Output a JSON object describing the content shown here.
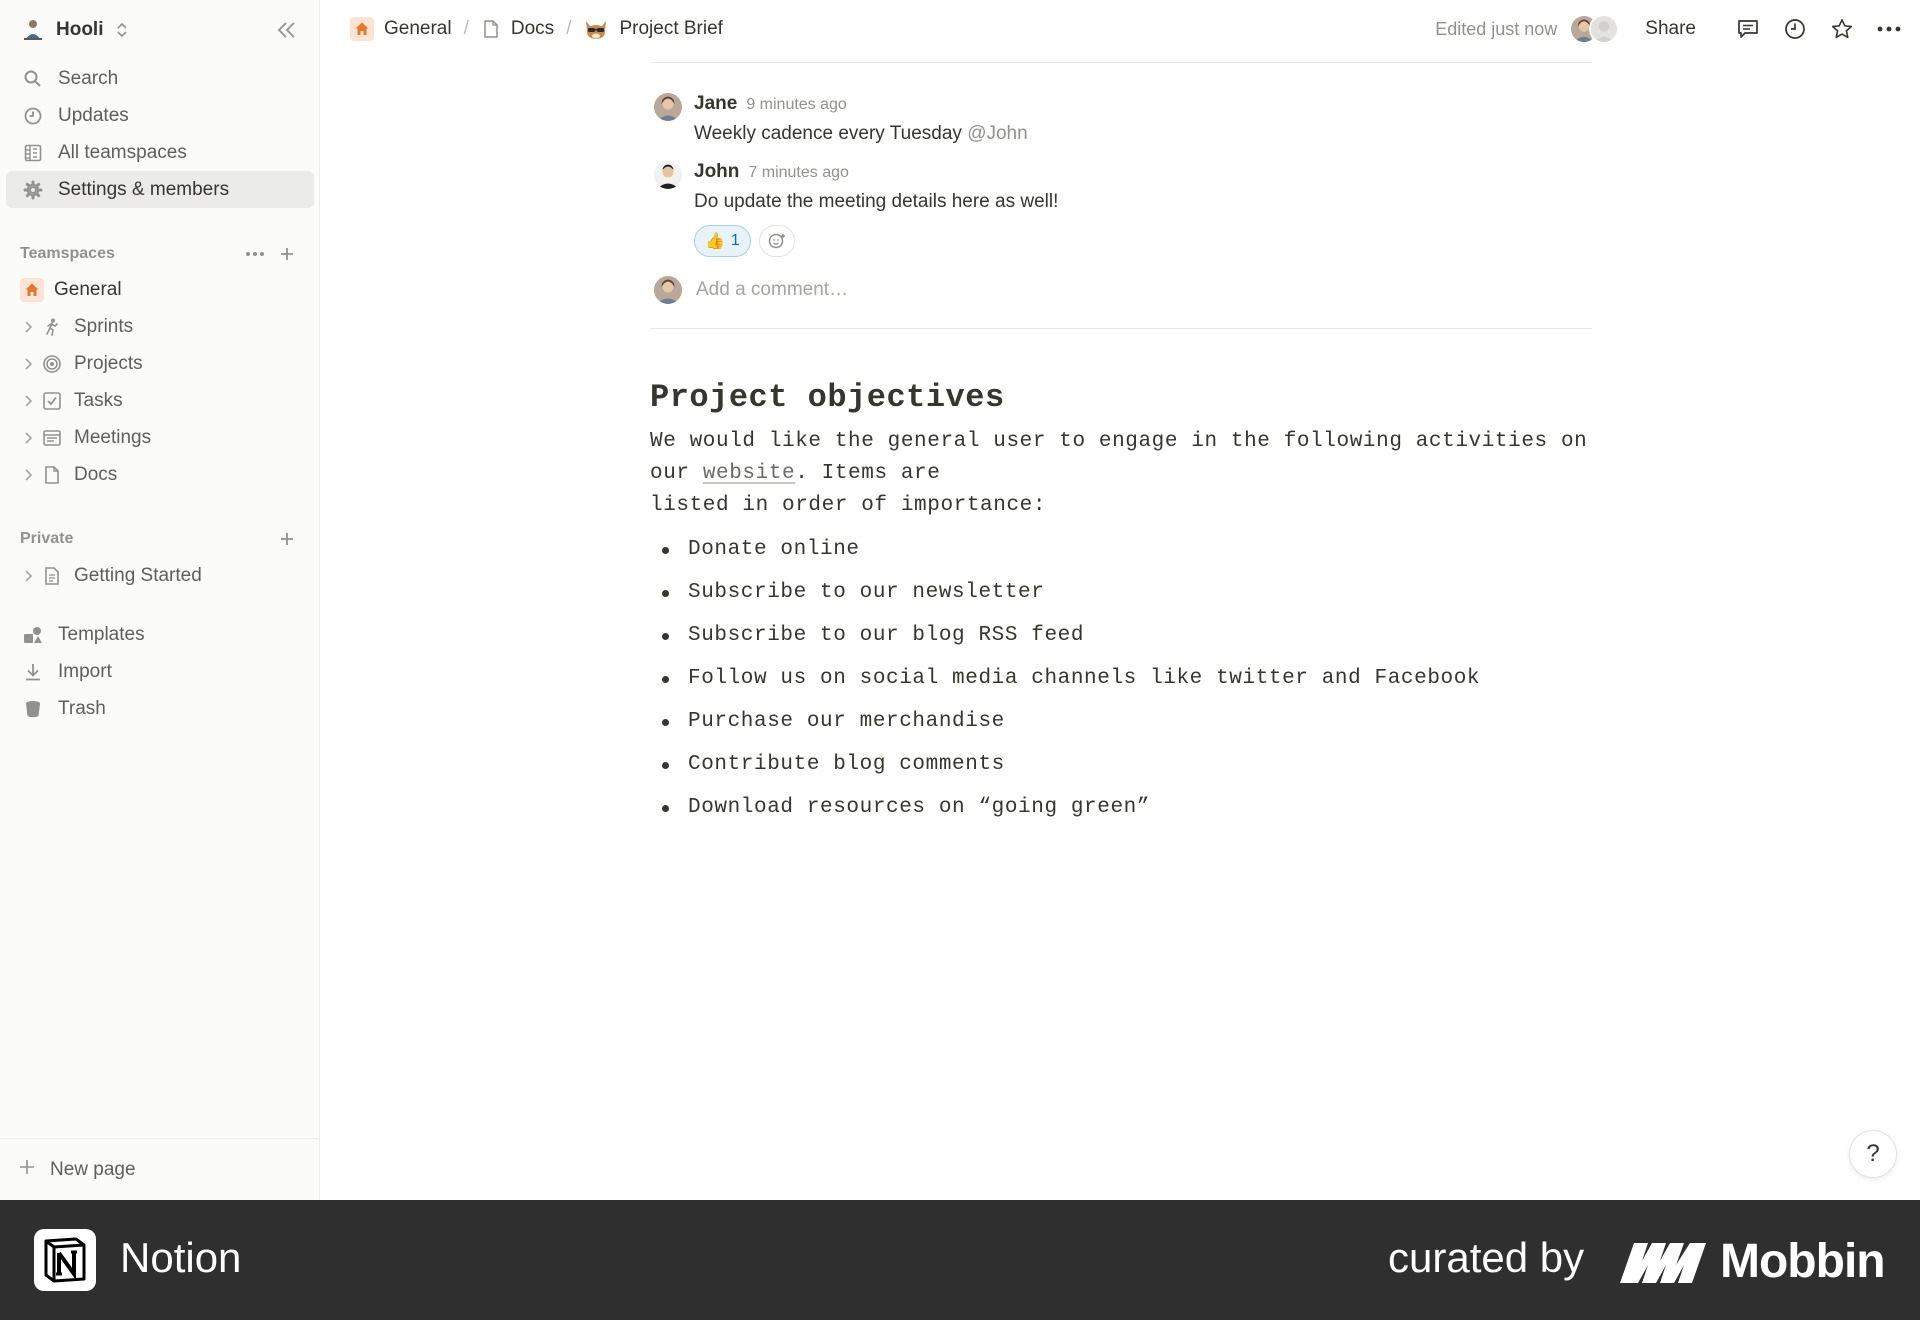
{
  "workspace": {
    "name": "Hooli"
  },
  "sidebar": {
    "nav": [
      {
        "label": "Search",
        "icon": "search-icon"
      },
      {
        "label": "Updates",
        "icon": "clock-icon"
      },
      {
        "label": "All teamspaces",
        "icon": "building-icon"
      },
      {
        "label": "Settings & members",
        "icon": "gear-icon",
        "active": true
      }
    ],
    "teamspaces_label": "Teamspaces",
    "teamspaces": [
      {
        "label": "General",
        "icon": "home-icon"
      },
      {
        "label": "Sprints",
        "icon": "runner-icon"
      },
      {
        "label": "Projects",
        "icon": "target-icon"
      },
      {
        "label": "Tasks",
        "icon": "checkbox-icon"
      },
      {
        "label": "Meetings",
        "icon": "calendar-icon"
      },
      {
        "label": "Docs",
        "icon": "page-icon"
      }
    ],
    "private_label": "Private",
    "private": [
      {
        "label": "Getting Started",
        "icon": "document-icon"
      }
    ],
    "bottom": [
      {
        "label": "Templates",
        "icon": "shapes-icon"
      },
      {
        "label": "Import",
        "icon": "download-icon"
      },
      {
        "label": "Trash",
        "icon": "trash-icon"
      }
    ],
    "new_page": "New page"
  },
  "topbar": {
    "breadcrumbs": [
      "General",
      "Docs",
      "Project Brief"
    ],
    "edited": "Edited just now",
    "share": "Share"
  },
  "comments": [
    {
      "author": "Jane",
      "time": "9 minutes ago",
      "text": "Weekly cadence every Tuesday",
      "mention": "@John"
    },
    {
      "author": "John",
      "time": "7 minutes ago",
      "text": "Do update the meeting details here as well!",
      "reaction": {
        "emoji": "👍",
        "count": "1"
      }
    }
  ],
  "add_comment_placeholder": "Add a comment…",
  "doc": {
    "heading": "Project objectives",
    "para_start": "We would like the general user to engage in the following activities on our ",
    "para_link": "website",
    "para_mid": ". Items are",
    "para_line2": "listed in order of importance:",
    "bullets": [
      "Donate online",
      "Subscribe to our newsletter",
      "Subscribe to our blog RSS feed",
      "Follow us on social media channels like twitter and Facebook",
      "Purchase our merchandise",
      "Contribute blog comments",
      "Download resources on “going green”"
    ]
  },
  "help_label": "?",
  "footer": {
    "app": "Notion",
    "curated": "curated by",
    "brand": "Mobbin"
  }
}
